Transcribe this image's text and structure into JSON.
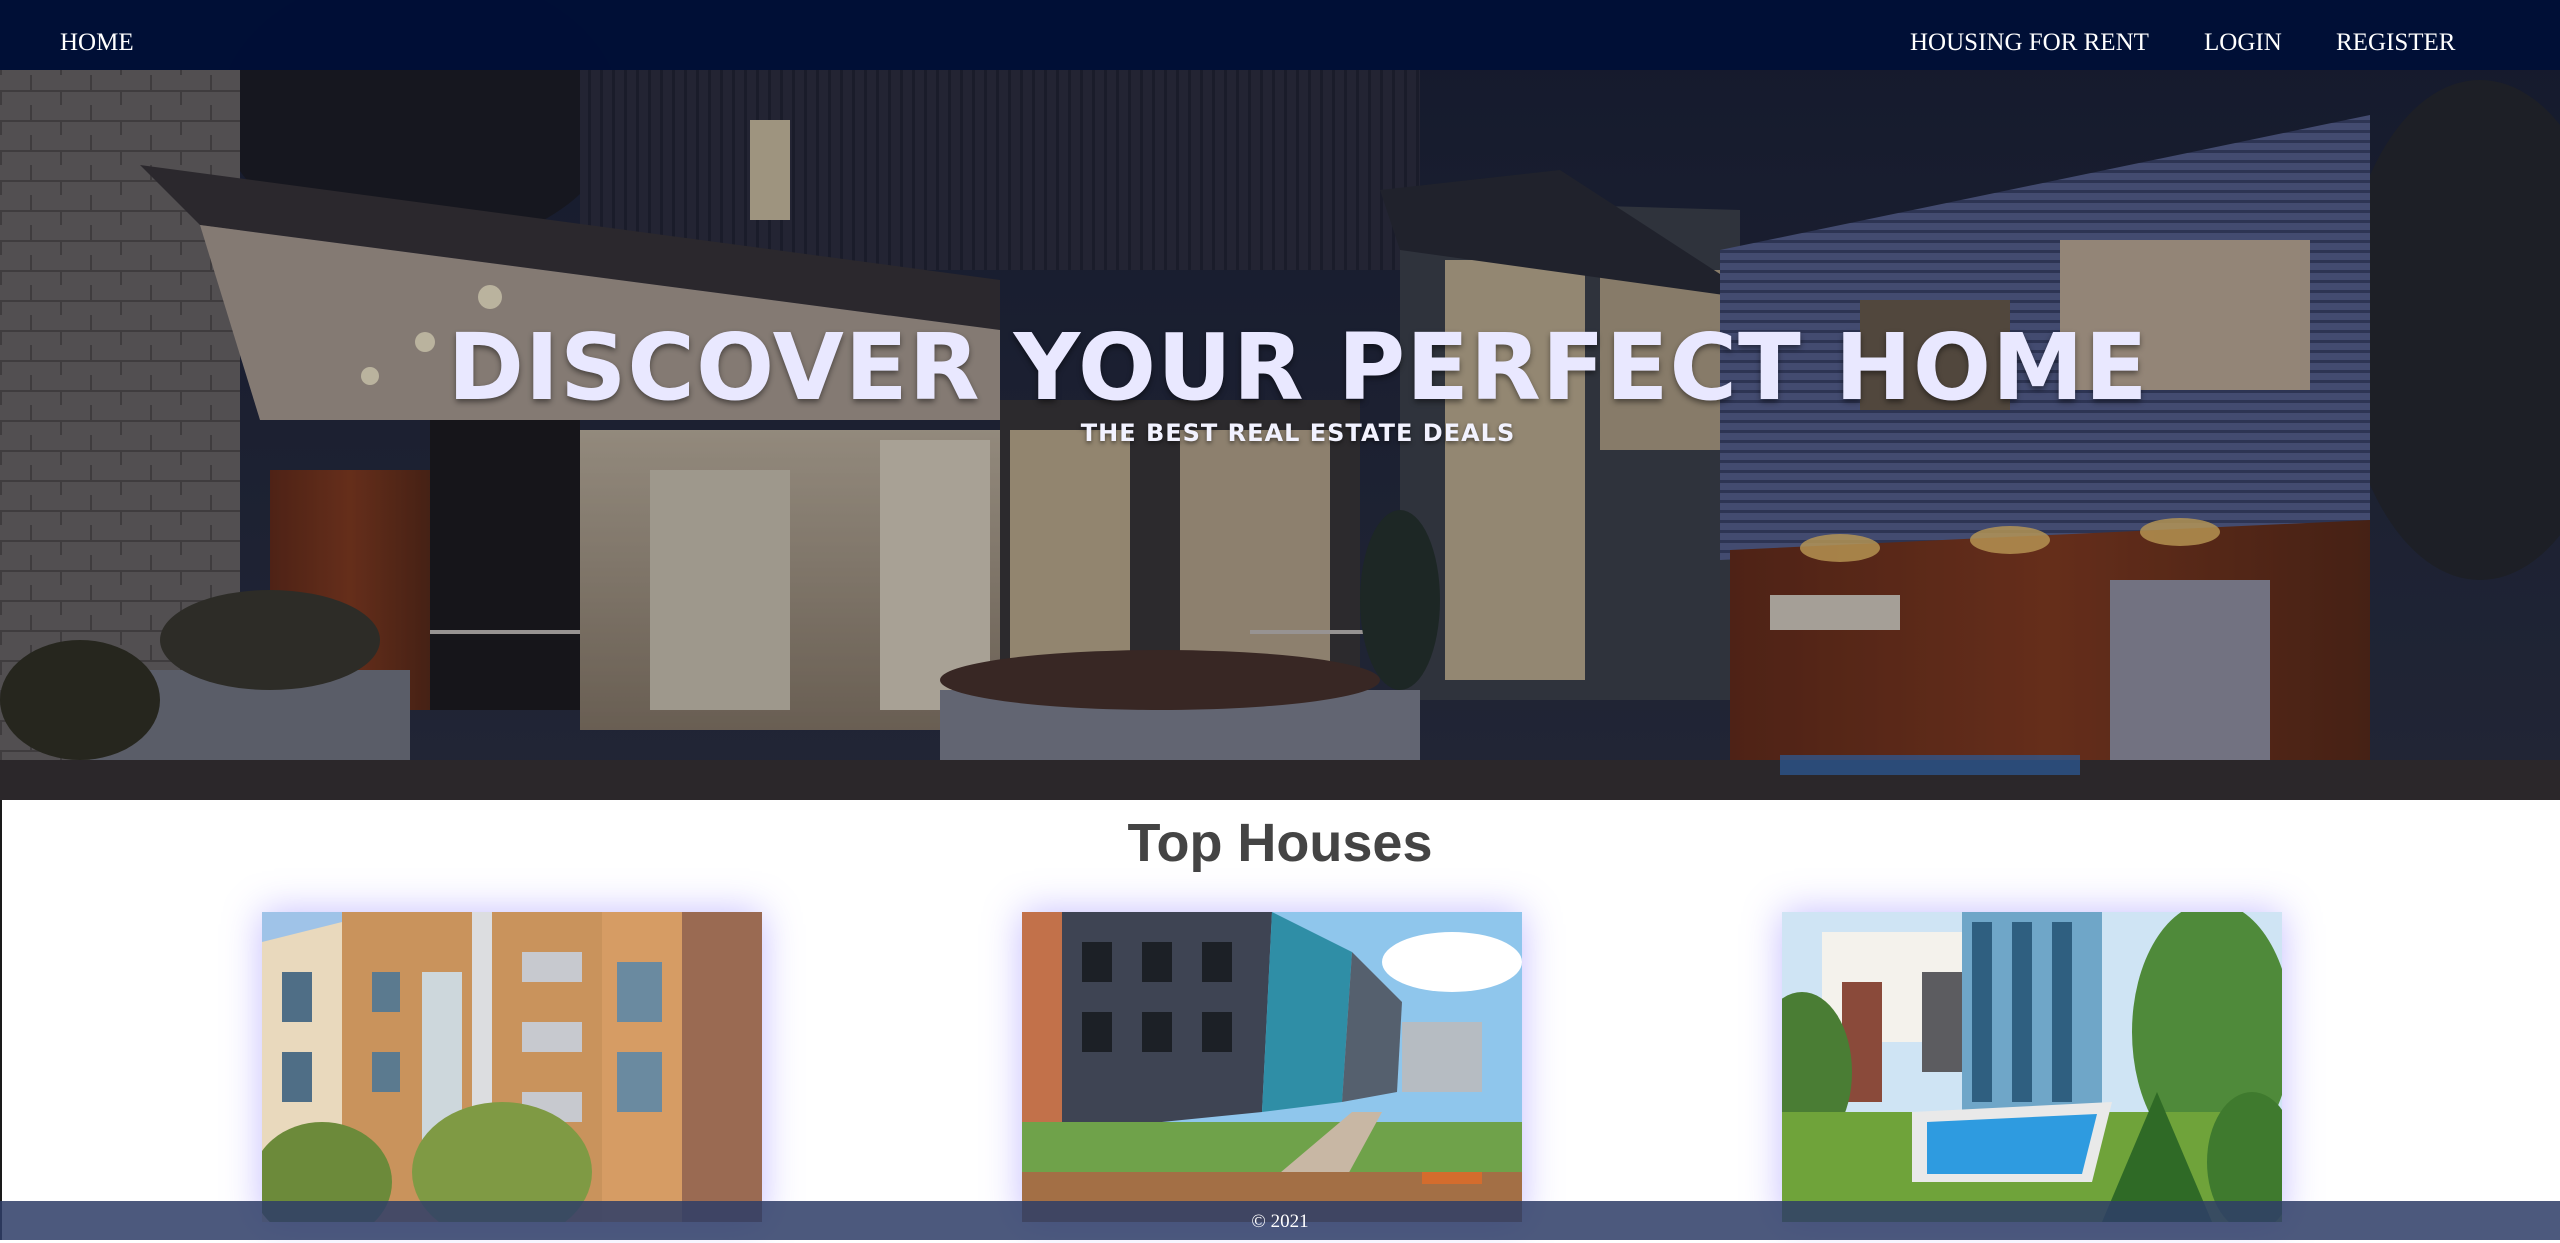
{
  "nav": {
    "home": "HOME",
    "housing_for_rent": "HOUSING FOR RENT",
    "login": "LOGIN",
    "register": "REGISTER"
  },
  "hero": {
    "title": "DISCOVER YOUR PERFECT HOME",
    "subtitle": "THE BEST REAL ESTATE DEALS"
  },
  "top_houses": {
    "title": "Top Houses"
  },
  "footer": {
    "copyright": "© 2021"
  },
  "colors": {
    "nav_bg": "#000f37",
    "hero_text": "#e9e8ff",
    "section_title": "#444444",
    "card_glow": "#6e5aff",
    "footer_bg": "#2e3e68"
  }
}
